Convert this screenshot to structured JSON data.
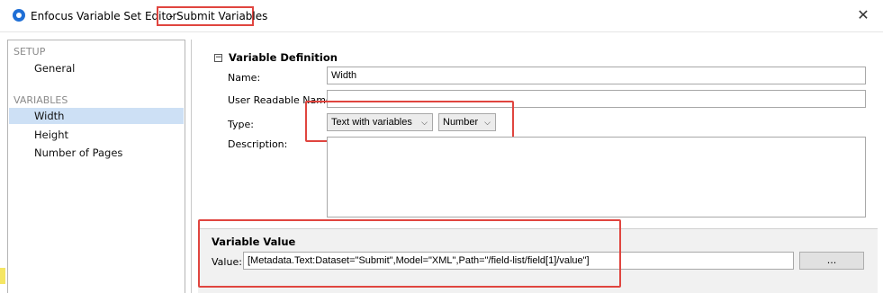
{
  "window": {
    "app_title": "Enfocus Variable Set Editor",
    "title_separator": "-",
    "document_title": "Submit Variables",
    "close_glyph": "✕"
  },
  "sidebar": {
    "sections": [
      {
        "header": "SETUP",
        "items": [
          {
            "label": "General",
            "selected": false
          }
        ]
      },
      {
        "header": "VARIABLES",
        "items": [
          {
            "label": "Width",
            "selected": true
          },
          {
            "label": "Height",
            "selected": false
          },
          {
            "label": "Number of Pages",
            "selected": false
          }
        ]
      }
    ]
  },
  "definition": {
    "toggle_glyph": "−",
    "title": "Variable Definition",
    "name_label": "Name:",
    "name_value": "Width",
    "user_readable_label": "User Readable Name:",
    "user_readable_value": "",
    "type_label": "Type:",
    "type_select_value": "Text with variables",
    "subtype_select_value": "Number",
    "description_label": "Description:",
    "description_value": ""
  },
  "value": {
    "title": "Variable Value",
    "label": "Value:",
    "expression": "[Metadata.Text:Dataset=\"Submit\",Model=\"XML\",Path=\"/field-list/field[1]/value\"]",
    "browse_label": "..."
  },
  "colors": {
    "highlight": "#e0453f",
    "selection": "#cde0f5",
    "app_icon": "#1f6fd6"
  }
}
